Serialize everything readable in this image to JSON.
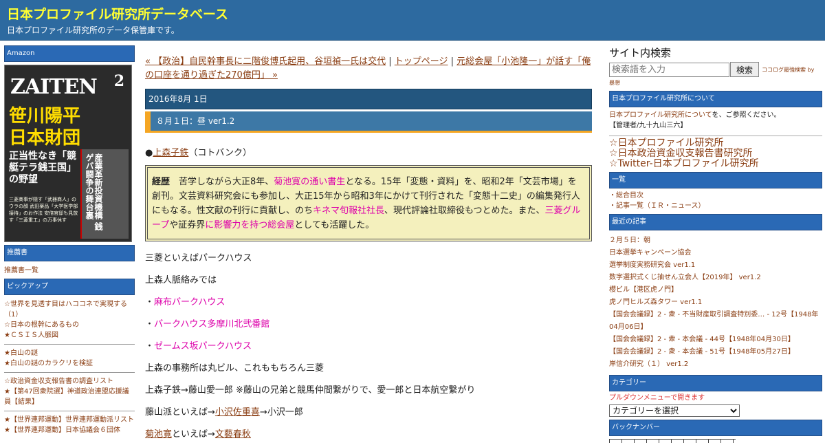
{
  "header": {
    "title": "日本プロファイル研究所データベース",
    "subtitle": "日本プロファイル研究所のデータ保管庫です。"
  },
  "left": {
    "amazon_label": "Amazon",
    "book": {
      "magazine": "ZAITEN",
      "issue": "2",
      "headline_line1": "笹川陽平",
      "headline_line2": "日本財団",
      "subhead": "正当性なき「競艇テラ銭王国」の野望",
      "side_text": "産業革新投資機構 銭ゲバ闘争の舞台裏",
      "bottom_text": "三菱商事が隠す「武器商人」のウラの顔 武田薬品「大学医学部接待」のお作法 安倍官邸も見放す「三菱重工」の万事休す"
    },
    "recommended_label": "推薦書",
    "recommended_list": "推薦書一覧",
    "pickup_label": "ピックアップ",
    "pickup_groups": [
      [
        "☆世界を見透す目はハココネで実現する（1）",
        "☆日本の根幹にあるもの",
        "★ＣＳＩＳ人脈図"
      ],
      [
        "★白山の謎",
        "★白山の謎のカラクリを検証"
      ],
      [
        "☆政治資金収支報告書の調査リスト",
        "★【第47回衆院選】神道政治連盟応援議員【結果】"
      ],
      [
        "★【世界連邦運動】世界連邦運動派リスト",
        "★【世界連邦運動】日本協議会６団体"
      ]
    ]
  },
  "main": {
    "nav": {
      "prev": "« 【政治】自民幹事長に二階俊博氏起用、谷垣禎一氏は交代",
      "sep": "|",
      "top": "トップページ",
      "next": "元総会屋「小池隆一」が話す「俺の口座を通り過ぎた270億円」 »"
    },
    "date": "2016年8月 1日",
    "post_title": "８月１日：昼 ver1.2",
    "bio": {
      "bullet": "●",
      "name": "上森子鉄",
      "source": "（コトバンク）"
    },
    "career": {
      "label": "経歴",
      "t1": "　苦学しながら大正8年、",
      "h1": "菊池寛の通い書生",
      "t2": "となる。15年「変態・資料」を、昭和2年「文芸市場」を創刊。文芸資料研究会にも参加し、大正15年から昭和3年にかけて刊行された「変態十二史」の編集発行人にもなる。性文献の刊行に貢献し、のち",
      "h2": "キネマ旬報社社長",
      "t3": "、現代評論社取締役もつとめた。また、",
      "h3": "三菱グループ",
      "t4": "や証券界",
      "h4": "に影響力を持つ総会屋",
      "t5": "としても活躍した。"
    },
    "p1": "三菱といえばパークハウス",
    "p2": "上森人脈絡みでは",
    "p3_bullet": "・",
    "p3": "麻布パークハウス",
    "p4_bullet": "・",
    "p4": "パークハウス多摩川北弐番館",
    "p5_bullet": "・",
    "p5": "ゼームス坂パークハウス",
    "p6": "上森の事務所は丸ビル、これももちろん三菱",
    "p7": "上森子鉄→藤山愛一郎 ※藤山の兄弟と競馬仲間繋がりで、愛一郎と日本航空繋がり",
    "p8_a": "藤山派といえば→",
    "p8_link": "小沢佐重喜",
    "p8_b": "→小沢一郎",
    "p9_link": "菊池寛",
    "p9_a": "といえば→",
    "p9_link2": "文藝春秋"
  },
  "right": {
    "search_title": "サイト内検索",
    "search_placeholder": "検索語を入力",
    "search_button": "検索",
    "powered_a": "ココログ最強検索 by",
    "powered_b": "暴想",
    "about_label": "日本プロファイル研究所について",
    "about_link": "日本プロファイル研究所について",
    "about_text": "を、ご参照ください。",
    "admin": "【管理者/九十九山三六】",
    "big_links": [
      "☆日本プロファイル研究所",
      "☆日本政治資金収支報告書研究所",
      "☆Twitter-日本プロファイル研究所"
    ],
    "list_label": "一覧",
    "list_items": [
      "・総合目次",
      "・記事一覧（ＩＲ・ニュース）"
    ],
    "recent_label": "最近の記事",
    "recent_items": [
      "２月５日：朝",
      "日本選挙キャンペーン協会",
      "選挙制度実務研究会 ver1.1",
      "数字選択式くじ抽せん立会人【2019年】 ver1.2",
      "櫻ビル【港区虎ノ門】",
      "虎ノ門ヒルズ森タワー ver1.1",
      "【国会会議録】2 - 衆 - 不当財産取引調査特別委… - 12号【1948年04月06日】",
      "【国会会議録】2 - 衆 - 本会議 - 44号【1948年04月30日】",
      "【国会会議録】2 - 衆 - 本会議 - 51号【1948年05月27日】",
      "岸信介研究（１） ver1.2"
    ],
    "category_label": "カテゴリー",
    "category_note": "プルダウンメニューで開きます",
    "category_select": "カテゴリーを選択",
    "backnumber_label": "バックナンバー"
  }
}
